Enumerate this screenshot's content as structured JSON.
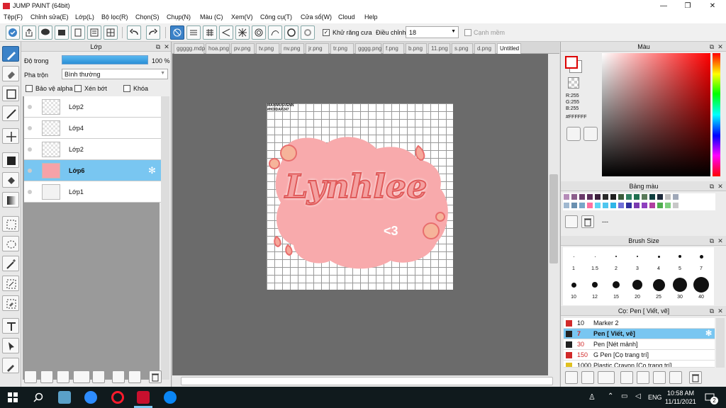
{
  "window": {
    "title": "JUMP PAINT (64bit)",
    "minimize": "—",
    "maximize": "❐",
    "close": "✕"
  },
  "menu": [
    "Tệp(F)",
    "Chỉnh sửa(E)",
    "Lớp(L)",
    "Bộ lọc(R)",
    "Chọn(S)",
    "Chụp(N)",
    "Màu (C)",
    "Xem(V)",
    "Công cụ(T)",
    "Cửa sổ(W)",
    "Cloud",
    "Help"
  ],
  "toolbar": {
    "antialias_label": "Khử răng cưa",
    "adjust_label": "Điều chỉnh",
    "adjust_value": "18",
    "smooth_label": "Cạnh mềm",
    "antialias_checked": true,
    "smooth_checked": false
  },
  "layer_panel": {
    "title": "Lớp",
    "opacity_label": "Độ trong",
    "opacity_value": "100 %",
    "opacity_fraction": 1.0,
    "blend_label": "Pha trộn",
    "blend_value": "Bình thường",
    "protect_alpha": "Bảo vệ alpha",
    "clip": "Xén bớt",
    "lock": "Khóa",
    "layers": [
      {
        "name": "Lớp2",
        "selected": false
      },
      {
        "name": "Lớp4",
        "selected": false
      },
      {
        "name": "Lớp2",
        "selected": false
      },
      {
        "name": "Lớp6",
        "selected": true
      },
      {
        "name": "Lớp1",
        "selected": false
      }
    ]
  },
  "tabs": [
    "ggggg.mdp",
    "hoa.png",
    "pv.png",
    "tv.png",
    "nv.png",
    "jr.png",
    "tr.png",
    "gggg.png",
    "f.png",
    "b.png",
    "11.png",
    "s.png",
    "d.png",
    "Untitled"
  ],
  "active_tab": "Untitled",
  "canvas": {
    "watermark_line1": "MAXIMUSVENN",
    "watermark_line2": "#HOIDAP247",
    "art_text": "Lynhlee",
    "art_subtext": "<3"
  },
  "color_panel": {
    "title": "Màu",
    "r": "R:255",
    "g": "G:255",
    "b": "B:255",
    "hex": "#FFFFFF"
  },
  "palette_panel": {
    "title": "Bảng màu",
    "dash": "---",
    "swatches": [
      "#b58cb8",
      "#8c5f8c",
      "#6a3a6a",
      "#5a2d5a",
      "#3b1f3b",
      "#2a2a2a",
      "#1e1e1e",
      "#3b5b3b",
      "#2f7f5f",
      "#1f6f4f",
      "#5a7a5a",
      "#0f3f3f",
      "#1e2a3a",
      "#c0c0c0",
      "#9fa8b8",
      "#a0b8d0",
      "#6a90b0",
      "#7aa6c8",
      "#ff6fa0",
      "#5fd4f4",
      "#4fc6ef",
      "#2fb6e8",
      "#6f6fd8",
      "#3030a0",
      "#7a3ab0",
      "#8f3fbf",
      "#b03fa0",
      "#4fae4f",
      "#7fcf7f",
      "#c8c8c8"
    ]
  },
  "brush_size_panel": {
    "title": "Brush Size",
    "sizes_row1": [
      "1",
      "1.5",
      "2",
      "3",
      "4",
      "5",
      "7"
    ],
    "sizes_row2": [
      "10",
      "12",
      "15",
      "20",
      "25",
      "30",
      "40"
    ]
  },
  "brush_panel": {
    "title": "Cọ: Pen [ Viết, vẽ]",
    "brushes": [
      {
        "size": "10",
        "name": "Marker 2",
        "color": "#d12a2a",
        "selected": false
      },
      {
        "size": "7",
        "name": "Pen [ Viết, vẽ]",
        "color": "#222222",
        "selected": true
      },
      {
        "size": "30",
        "name": "Pen [Nét mảnh]",
        "color": "#d12a2a",
        "selected": false
      },
      {
        "size": "150",
        "name": "G Pen [Cọ trang trí]",
        "color": "#d12a2a",
        "selected": false
      },
      {
        "size": "1000",
        "name": "Plastic Crayon [Cọ trang trí]",
        "color": "#e0c020",
        "selected": false
      }
    ]
  },
  "taskbar": {
    "lang": "ENG",
    "time": "10:58 AM",
    "date": "11/11/2021",
    "notif_count": "2"
  }
}
